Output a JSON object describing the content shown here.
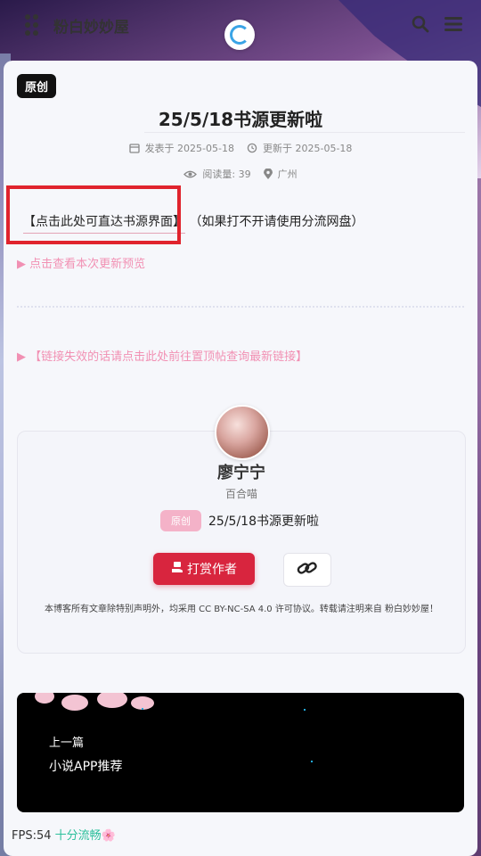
{
  "header": {
    "site_title": "粉白妙妙屋",
    "icons": [
      "grid-menu-icon",
      "loading-spinner-icon",
      "search-icon",
      "hamburger-menu-icon"
    ]
  },
  "post": {
    "badge": "原创",
    "title": "25/5/18书源更新啦",
    "published_label": "发表于 2025-05-18",
    "updated_label": "更新于 2025-05-18",
    "views_label": "阅读量: 39",
    "location": "广州",
    "main_link": "【点击此处可直达书源界面】",
    "main_link_note": "（如果打不开请使用分流网盘）",
    "preview_toggle": "▶ 点击查看本次更新预览",
    "expired_link": "▶ 【链接失效的话请点击此处前往置顶帖查询最新链接】"
  },
  "author": {
    "name": "廖宁宁",
    "subtitle": "百合喵",
    "orig_badge": "原创",
    "orig_title": "25/5/18书源更新啦",
    "tip_button": "打赏作者",
    "license": "本博客所有文章除特别声明外，均采用 CC BY-NC-SA 4.0 许可协议。转载请注明来自 粉白妙妙屋！"
  },
  "prev_post": {
    "label": "上一篇",
    "title": "小说APP推荐"
  },
  "fps": {
    "label": "FPS:54",
    "status": "十分流畅🌸"
  },
  "colors": {
    "accent_pink": "#f06e9c",
    "tip_red": "#d8253e",
    "highlight_box": "#e0232d",
    "fps_good": "#2bbf9b"
  }
}
